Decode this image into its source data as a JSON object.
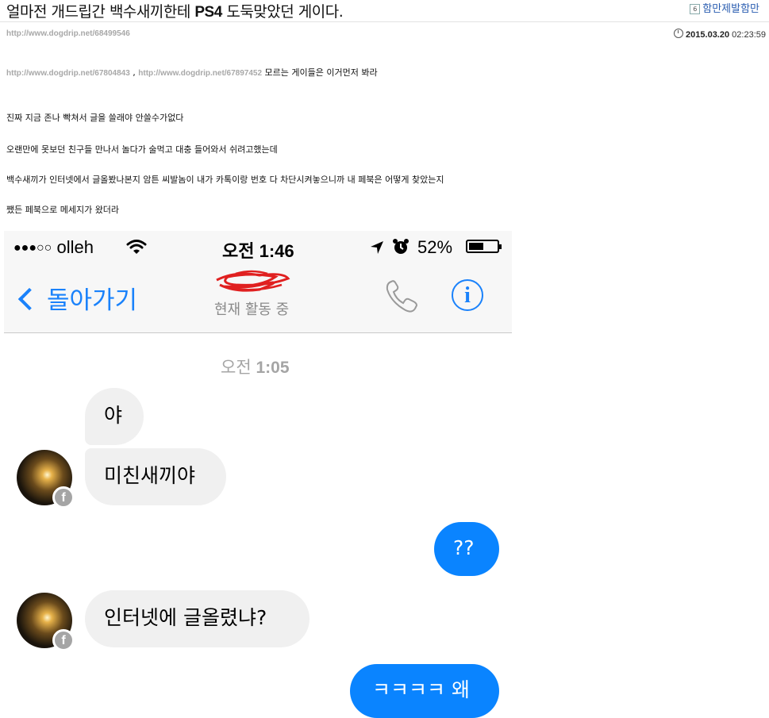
{
  "post": {
    "title_part1": "얼마전 개드립간 백수새끼한테 ",
    "title_bold": "PS4",
    "title_part2": " 도둑맞았던 게이다.",
    "author_badge": "6",
    "author": "함만제발함만",
    "url": "http://www.dogdrip.net/68499546",
    "date": "2015.03.20",
    "time": "02:23:59"
  },
  "body": {
    "link1": "http://www.dogdrip.net/67804843",
    "sep": " , ",
    "link2": "http://www.dogdrip.net/67897452",
    "link_note": " 모르는 게이들은 이거먼저 봐라",
    "p1": "진짜 지금 존나 빡쳐서 글을 쓸래야 안쓸수가없다",
    "p2": "오랜만에 못보던 친구들 만나서 놀다가 술먹고 대충 들어와서 쉬려고했는데",
    "p3": "백수새끼가 인터넷에서 글올봤나본지 암튼 씨발놈이 내가 카톡이랑 번호 다 차단시켜놓으니까 내 페북은 어떻게 찾았는지",
    "p4": "쨌든 페북으로 메세지가 왔더라"
  },
  "phone": {
    "signal": "●●●○○",
    "carrier": "olleh",
    "clock": "오전 1:46",
    "battery": "52%",
    "battery_level": 0.52,
    "back_label": "돌아가기",
    "contact_status": "현재 활동 중",
    "icons": [
      "wifi-icon",
      "location-arrow-icon",
      "alarm-icon",
      "phone-icon",
      "info-icon"
    ],
    "accent": "#0a84ff"
  },
  "chat": {
    "timestamp_prefix": "오전 ",
    "timestamp_time": "1:05",
    "messages": [
      {
        "from": "them",
        "text": "야"
      },
      {
        "from": "them",
        "text": "미친새끼야"
      },
      {
        "from": "me",
        "text": "??"
      },
      {
        "from": "them",
        "text": "인터넷에 글올렸냐?"
      },
      {
        "from": "me",
        "text": "ㅋㅋㅋㅋ 왜"
      }
    ]
  }
}
